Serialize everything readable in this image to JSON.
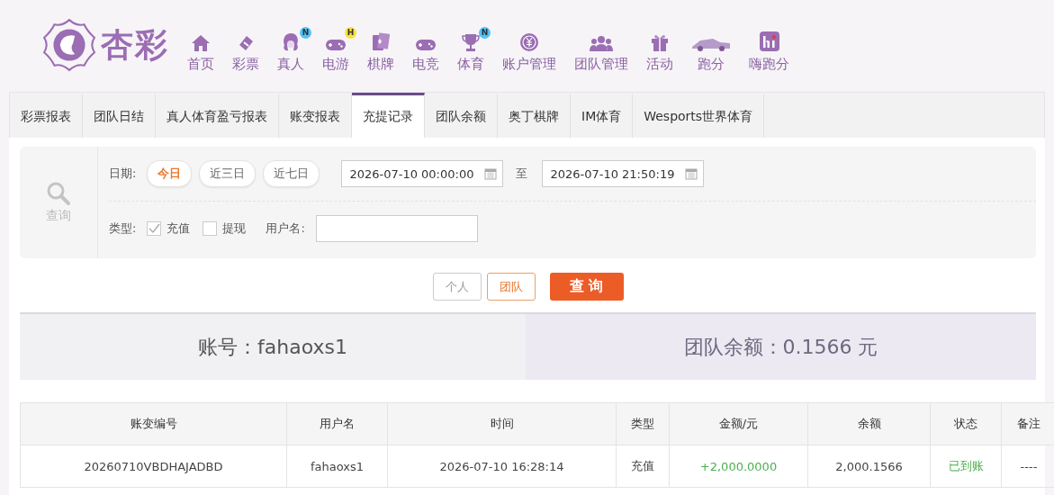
{
  "brand": {
    "name": "杏彩"
  },
  "nav": [
    {
      "label": "首页",
      "kind": "home"
    },
    {
      "label": "彩票",
      "kind": "ticket"
    },
    {
      "label": "真人",
      "kind": "lady",
      "badge": "N",
      "color": "#4fc3f7"
    },
    {
      "label": "电游",
      "kind": "gamepad",
      "badge": "H",
      "color": "#f4e23c"
    },
    {
      "label": "棋牌",
      "kind": "cards"
    },
    {
      "label": "电竞",
      "kind": "gamepad"
    },
    {
      "label": "体育",
      "kind": "trophy",
      "badge": "N",
      "color": "#4fc3f7"
    },
    {
      "label": "账户管理",
      "kind": "coin"
    },
    {
      "label": "团队管理",
      "kind": "group"
    },
    {
      "label": "活动",
      "kind": "gift"
    },
    {
      "label": "跑分",
      "kind": "car"
    },
    {
      "label": "嗨跑分",
      "kind": "hi"
    }
  ],
  "tabs": [
    {
      "label": "彩票报表",
      "selected": false
    },
    {
      "label": "团队日结",
      "selected": false
    },
    {
      "label": "真人体育盈亏报表",
      "selected": false
    },
    {
      "label": "账变报表",
      "selected": false
    },
    {
      "label": "充提记录",
      "selected": true
    },
    {
      "label": "团队余额",
      "selected": false
    },
    {
      "label": "奥丁棋牌",
      "selected": false
    },
    {
      "label": "IM体育",
      "selected": false
    },
    {
      "label": "Wesports世界体育",
      "selected": false
    }
  ],
  "filter": {
    "search_label": "查询",
    "date_label": "日期:",
    "date_presets": [
      {
        "label": "今日",
        "selected": true
      },
      {
        "label": "近三日",
        "selected": false
      },
      {
        "label": "近七日",
        "selected": false
      }
    ],
    "start": "2026-07-10 00:00:00",
    "to": "至",
    "end": "2026-07-10 21:50:19",
    "type_label": "类型:",
    "types": [
      {
        "label": "充值",
        "checked": true
      },
      {
        "label": "提现",
        "checked": false
      }
    ],
    "username_label": "用户名:"
  },
  "scope": [
    {
      "label": "个人",
      "selected": false
    },
    {
      "label": "团队",
      "selected": true
    }
  ],
  "query_button": "查 询",
  "summary": {
    "account": "账号：fahaoxs1",
    "team_balance": "团队余额：0.1566 元"
  },
  "table": {
    "columns": [
      "账变编号",
      "用户名",
      "时间",
      "类型",
      "金额/元",
      "余额",
      "状态",
      "备注"
    ],
    "rows": [
      [
        "20260710VBDHAJADBD",
        "fahaoxs1",
        "2026-07-10 16:28:14",
        "充值",
        "+2,000.0000",
        "2,000.1566",
        "已到账",
        "----"
      ]
    ]
  }
}
